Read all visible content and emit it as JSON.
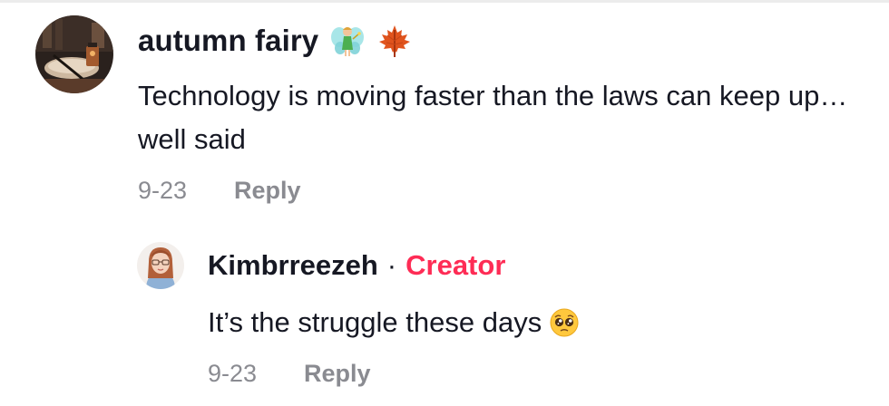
{
  "parent": {
    "username": "autumn fairy",
    "emoji_1": "fairy-icon",
    "emoji_2": "maple-leaf-icon",
    "text": "Technology is moving faster than the laws can keep up… well said",
    "date": "9-23",
    "reply_label": "Reply"
  },
  "reply": {
    "username": "Kimbrreezeh",
    "separator": "·",
    "badge": "Creator",
    "text": "It’s the struggle these days",
    "emoji": "pleading-face-icon",
    "date": "9-23",
    "reply_label": "Reply"
  },
  "colors": {
    "text_primary": "#161823",
    "text_secondary": "#8a8b91",
    "creator_accent": "#fe2c55",
    "divider": "#ececec"
  }
}
